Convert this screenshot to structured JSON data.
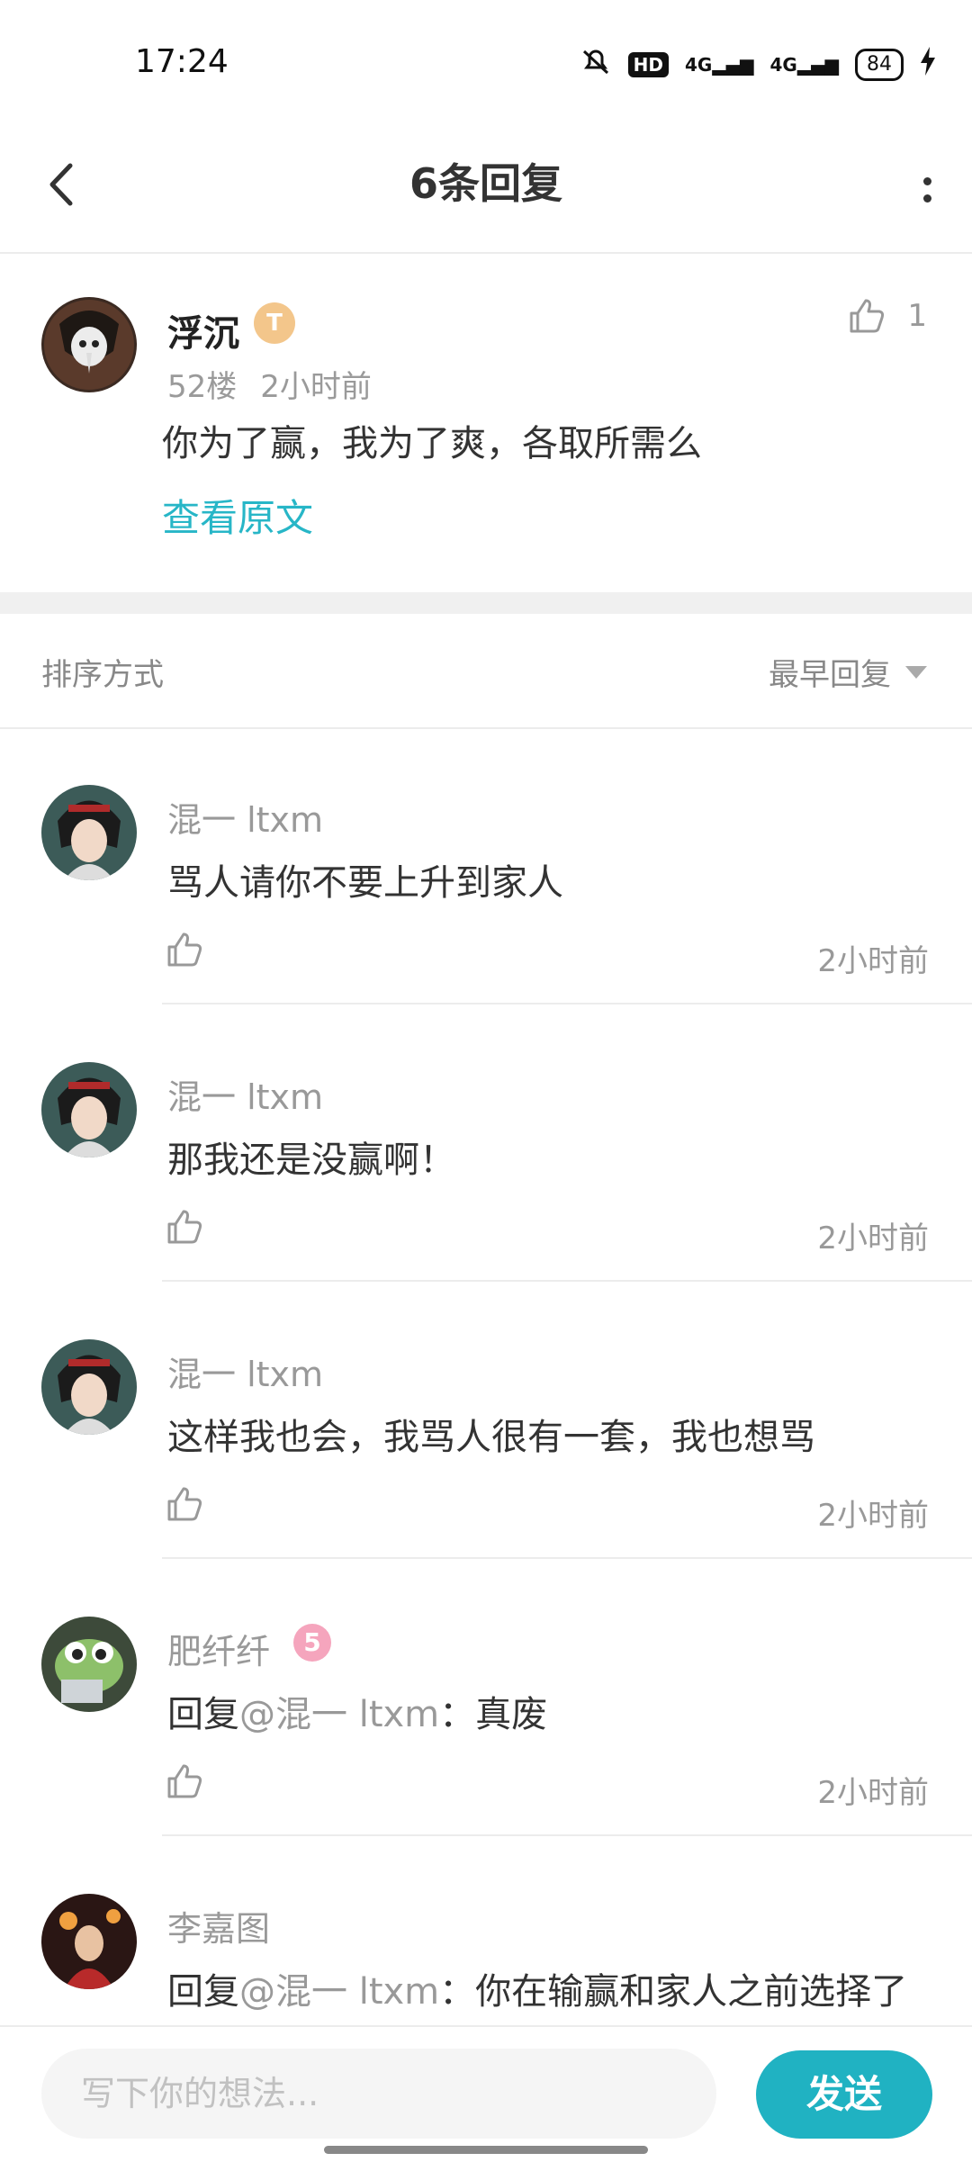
{
  "status_bar": {
    "time": "17:24",
    "hd": "HD",
    "signal1": "4G",
    "signal2": "4G",
    "battery": "84",
    "icons": [
      "mute-icon",
      "hd-icon",
      "signal-icon",
      "battery-icon",
      "charging-icon"
    ]
  },
  "header": {
    "title": "6条回复",
    "back_icon": "chevron-left-icon",
    "more_icon": "more-vertical-icon"
  },
  "original_post": {
    "author": "浮沉",
    "badge": "T",
    "floor": "52楼",
    "time": "2小时前",
    "text": "你为了赢，我为了爽，各取所需么",
    "view_original": "查看原文",
    "like_count": "1"
  },
  "sort": {
    "label": "排序方式",
    "value": "最早回复"
  },
  "replies": [
    {
      "author": "混一 ltxm",
      "text": "骂人请你不要上升到家人",
      "time": "2小时前"
    },
    {
      "author": "混一 ltxm",
      "text": "那我还是没赢啊！",
      "time": "2小时前"
    },
    {
      "author": "混一 ltxm",
      "text": "这样我也会，我骂人很有一套，我也想骂",
      "time": "2小时前"
    },
    {
      "author": "肥纤纤",
      "badge": "5",
      "reply_prefix": "回复",
      "mention": "@混一 ltxm",
      "text": "：真废",
      "time": "2小时前"
    },
    {
      "author": "李嘉图",
      "reply_prefix": "回复",
      "mention": "@混一 ltxm",
      "text": "：你在输赢和家人之前选择了",
      "time": ""
    }
  ],
  "composer": {
    "placeholder": "写下你的想法...",
    "send_label": "发送"
  },
  "colors": {
    "accent": "#20b2c2",
    "link": "#27b6c7"
  }
}
